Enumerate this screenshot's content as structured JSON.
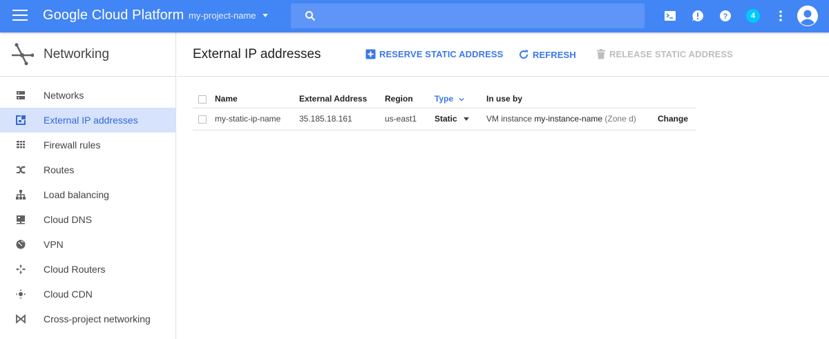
{
  "topbar": {
    "brand": "Google Cloud Platform",
    "project": "my-project-name",
    "search_placeholder": "",
    "notification_count": "4",
    "icons": [
      "cloud-shell-icon",
      "notifications-icon",
      "help-icon",
      "more-vert-icon",
      "account-avatar-icon"
    ],
    "color": "#4285f4"
  },
  "sidebar": {
    "title": "Networking",
    "items": [
      {
        "label": "Networks",
        "icon": "networks-icon",
        "active": false
      },
      {
        "label": "External IP addresses",
        "icon": "external-ip-icon",
        "active": true
      },
      {
        "label": "Firewall rules",
        "icon": "firewall-icon",
        "active": false
      },
      {
        "label": "Routes",
        "icon": "routes-icon",
        "active": false
      },
      {
        "label": "Load balancing",
        "icon": "load-balancing-icon",
        "active": false
      },
      {
        "label": "Cloud DNS",
        "icon": "cloud-dns-icon",
        "active": false
      },
      {
        "label": "VPN",
        "icon": "vpn-icon",
        "active": false
      },
      {
        "label": "Cloud Routers",
        "icon": "cloud-routers-icon",
        "active": false
      },
      {
        "label": "Cloud CDN",
        "icon": "cloud-cdn-icon",
        "active": false
      },
      {
        "label": "Cross-project networking",
        "icon": "cross-project-icon",
        "active": false
      }
    ]
  },
  "main": {
    "title": "External IP addresses",
    "actions": {
      "reserve": "RESERVE STATIC ADDRESS",
      "refresh": "REFRESH",
      "release": "RELEASE STATIC ADDRESS"
    },
    "table": {
      "headers": {
        "name": "Name",
        "address": "External Address",
        "region": "Region",
        "type": "Type",
        "in_use": "In use by"
      },
      "rows": [
        {
          "name": "my-static-ip-name",
          "address": "35.185.18.161",
          "region": "us-east1",
          "type": "Static",
          "in_use_prefix": "VM instance",
          "in_use_instance": "my-instance-name",
          "in_use_zone": "(Zone d)",
          "action": "Change"
        }
      ]
    }
  }
}
